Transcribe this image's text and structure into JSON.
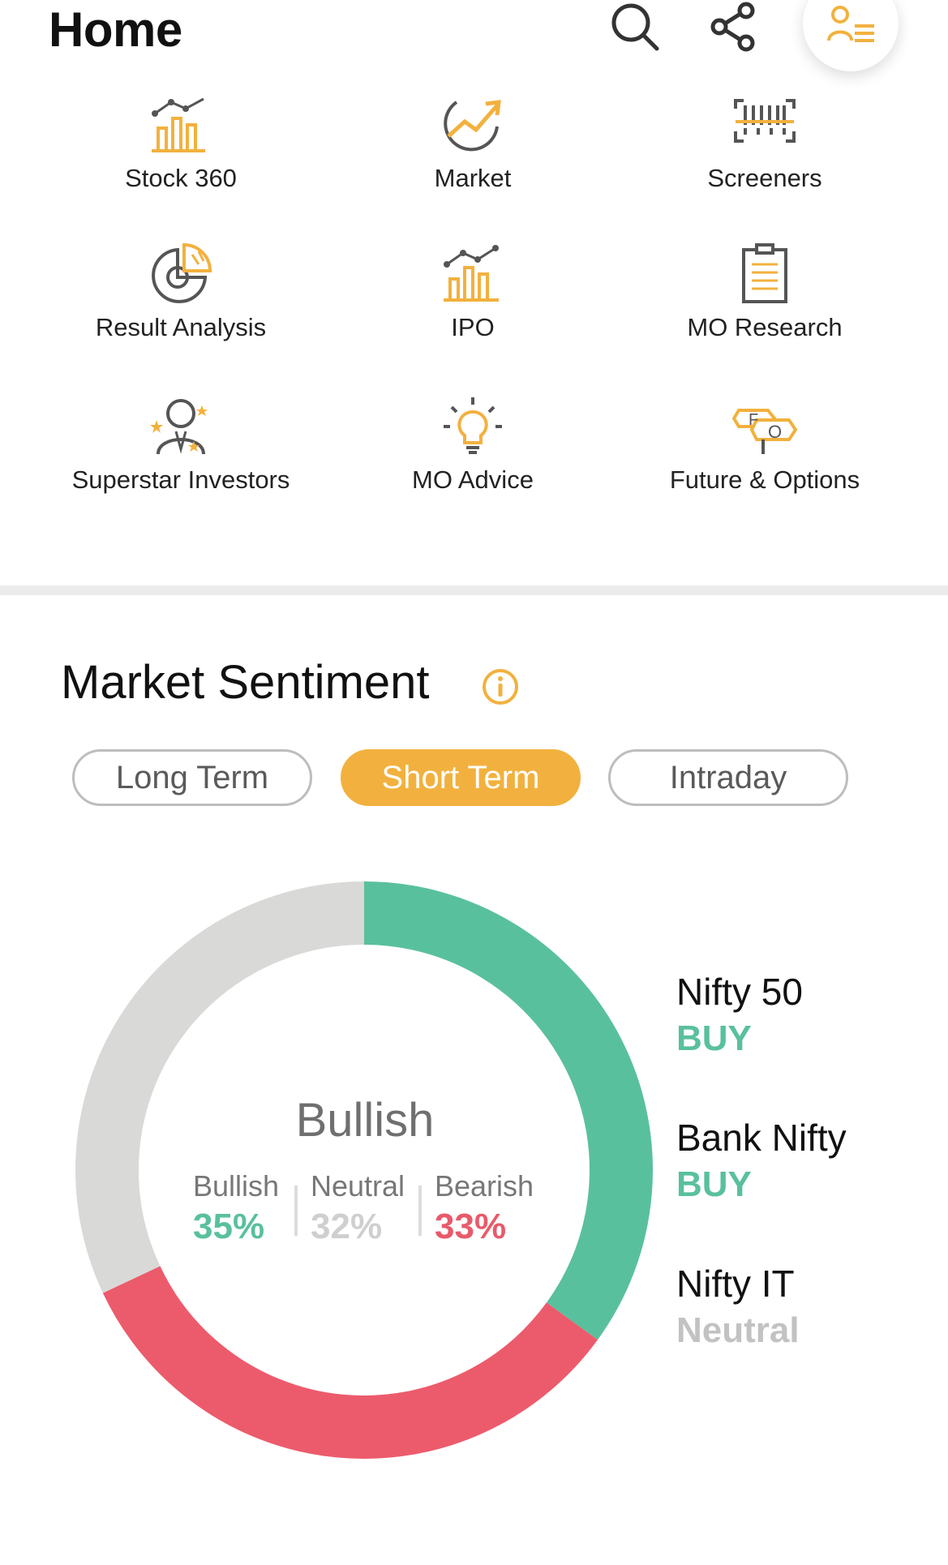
{
  "header": {
    "title": "Home",
    "icons": [
      "search-icon",
      "share-icon",
      "profile-list-icon"
    ]
  },
  "quick_links": [
    {
      "label": "Stock 360",
      "icon": "bar-chart-line-icon"
    },
    {
      "label": "Market",
      "icon": "trend-arrow-icon"
    },
    {
      "label": "Screeners",
      "icon": "barcode-scanner-icon"
    },
    {
      "label": "Result Analysis",
      "icon": "pie-chart-icon"
    },
    {
      "label": "IPO",
      "icon": "bar-chart-line-icon"
    },
    {
      "label": "MO Research",
      "icon": "clipboard-icon"
    },
    {
      "label": "Superstar Investors",
      "icon": "investor-star-icon"
    },
    {
      "label": "MO Advice",
      "icon": "lightbulb-icon"
    },
    {
      "label": "Future & Options",
      "icon": "fo-signpost-icon"
    }
  ],
  "sentiment": {
    "title": "Market Sentiment",
    "tabs": [
      {
        "label": "Long Term",
        "active": false
      },
      {
        "label": "Short Term",
        "active": true
      },
      {
        "label": "Intraday",
        "active": false
      }
    ],
    "overall": "Bullish",
    "breakdown": [
      {
        "label": "Bullish",
        "value": "35%",
        "color": "#59c09d"
      },
      {
        "label": "Neutral",
        "value": "32%",
        "color": "#cfcfcf"
      },
      {
        "label": "Bearish",
        "value": "33%",
        "color": "#e85a6a"
      }
    ],
    "indices": [
      {
        "name": "Nifty 50",
        "signal": "BUY",
        "color": "#59c09d"
      },
      {
        "name": "Bank Nifty",
        "signal": "BUY",
        "color": "#59c09d"
      },
      {
        "name": "Nifty IT",
        "signal": "Neutral",
        "color": "#c2c2c2"
      }
    ]
  },
  "chart_data": {
    "type": "pie",
    "categories": [
      "Bullish",
      "Bearish",
      "Neutral"
    ],
    "values": [
      35,
      33,
      32
    ],
    "colors": [
      "#59c09d",
      "#ec5b6c",
      "#d9d9d7"
    ]
  },
  "colors": {
    "accent": "#f2b13e",
    "bullish": "#59c09d",
    "bearish": "#e85a6a",
    "neutral": "#c2c2c2"
  }
}
